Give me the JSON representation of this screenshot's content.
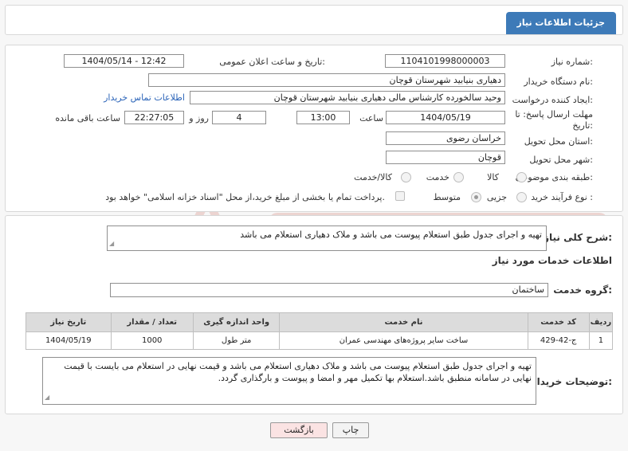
{
  "header": {
    "title": "جزئیات اطلاعات نیاز"
  },
  "fields": {
    "need_number_label": "شماره نیاز:",
    "need_number": "1104101998000003",
    "announce_label": "تاریخ و ساعت اعلان عمومی:",
    "announce_value": "1404/05/14 - 12:42",
    "buyer_org_label": "نام دستگاه خریدار:",
    "buyer_org": "دهیاری بنیابید شهرستان قوچان",
    "creator_label": "ایجاد کننده درخواست:",
    "creator": "وحید سالخورده کارشناس مالی دهیاری بنیابید شهرستان قوچان",
    "contact_link": "اطلاعات تماس خریدار",
    "deadline_label_1": "مهلت ارسال پاسخ: تا",
    "deadline_label_2": "تاریخ:",
    "deadline_date": "1404/05/19",
    "time_label": "ساعت",
    "deadline_time": "13:00",
    "days": "4",
    "days_label": "روز و",
    "remaining_time": "22:27:05",
    "remaining_label": "ساعت باقی مانده",
    "province_label": "استان محل تحویل:",
    "province": "خراسان رضوی",
    "city_label": "شهر محل تحویل:",
    "city": "قوچان",
    "category_label": "طبقه بندی موضوعی:",
    "category_options": [
      "کالا",
      "خدمت",
      "کالا/خدمت"
    ],
    "process_label": "نوع فرآیند خرید :",
    "process_options": [
      "جزیی",
      "متوسط"
    ],
    "payment_note": "پرداخت تمام یا بخشی از مبلغ خرید،از محل \"اسناد خزانه اسلامی\" خواهد بود."
  },
  "summary": {
    "label": "شرح کلی نیاز:",
    "text": "تهیه و اجرای جدول طبق استعلام پیوست می باشد و ملاک دهیاری استعلام می باشد"
  },
  "services": {
    "section_title": "اطلاعات خدمات مورد نیاز",
    "group_label": "گروه خدمت:",
    "group_value": "ساختمان",
    "columns": [
      "ردیف",
      "کد خدمت",
      "نام خدمت",
      "واحد اندازه گیری",
      "تعداد / مقدار",
      "تاریخ نیاز"
    ],
    "rows": [
      [
        "1",
        "ج-42-429",
        "ساخت سایر پروژه‌های مهندسی عمران",
        "متر طول",
        "1000",
        "1404/05/19"
      ]
    ]
  },
  "buyer_notes": {
    "label": "توضیحات خریدار:",
    "text": "تهیه و اجرای جدول طبق استعلام پیوست می باشد و ملاک دهیاری استعلام می باشد و قیمت نهایی در استعلام می بایست با قیمت نهایی در سامانه منطبق باشد.استعلام بها تکمیل مهر و امضا و پیوست و بارگذاری گردد."
  },
  "buttons": {
    "print": "چاپ",
    "back": "بازگشت"
  },
  "colors": {
    "header_tab": "#3d7ab8",
    "link": "#2a63b8",
    "back_button_bg": "#fbe3e3",
    "print_button_bg": "#f3f3f3"
  }
}
